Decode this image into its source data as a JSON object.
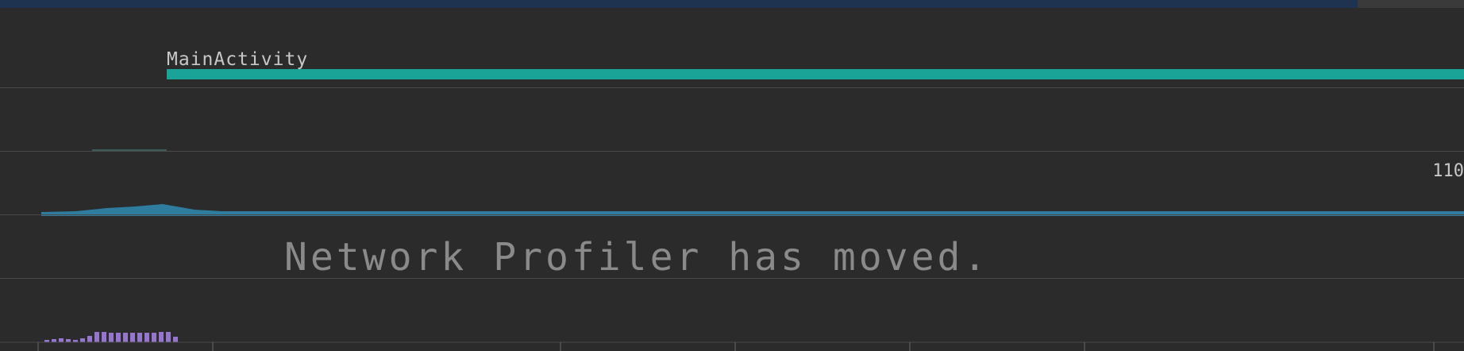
{
  "timeline": {
    "activity_label": "MainActivity",
    "activity_color": "#1aa497",
    "cpu_area_color": "#2e7d9e",
    "network_bar_color": "#9575cd",
    "background_color": "#2b2b2b",
    "max_label": "110",
    "overlay_message": "Network Profiler has moved."
  }
}
